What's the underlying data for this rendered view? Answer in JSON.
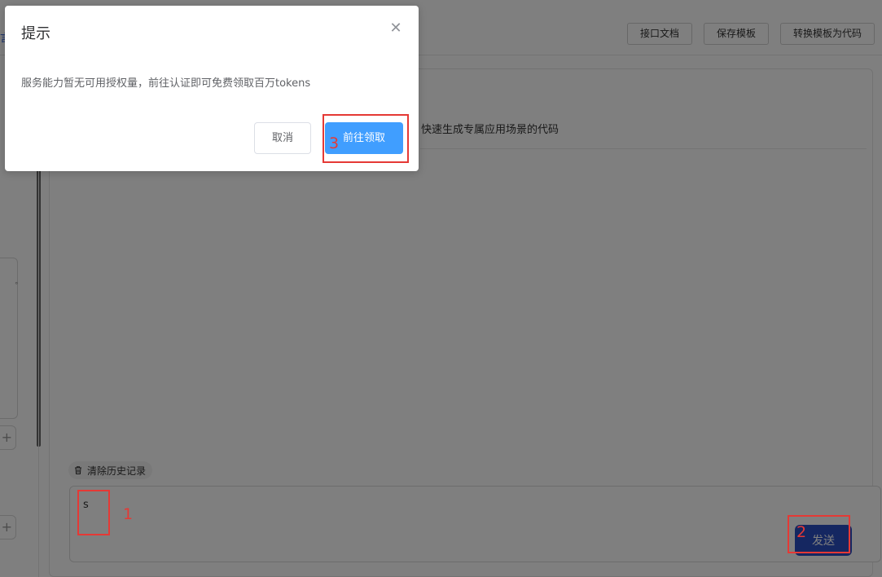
{
  "topbar": {
    "left_crumb": "言",
    "buttons": [
      "接口文档",
      "保存模板",
      "转换模板为代码"
    ]
  },
  "sidebar": {
    "plus_icon": "plus-icon"
  },
  "main": {
    "description": "快速生成专属应用场景的代码",
    "clear_history_label": "清除历史记录",
    "input_value": "s",
    "send_label": "发送"
  },
  "dialog": {
    "title": "提示",
    "message": "服务能力暂无可用授权量，前往认证即可免费领取百万tokens",
    "close_icon": "close-icon",
    "cancel_label": "取消",
    "confirm_label": "前往领取"
  },
  "annotations": [
    "1",
    "2",
    "3"
  ],
  "colors": {
    "primary": "#409eff",
    "send": "#2b4fc2",
    "annotation": "#e53935",
    "overlay": "rgba(0,0,0,0.5)"
  }
}
